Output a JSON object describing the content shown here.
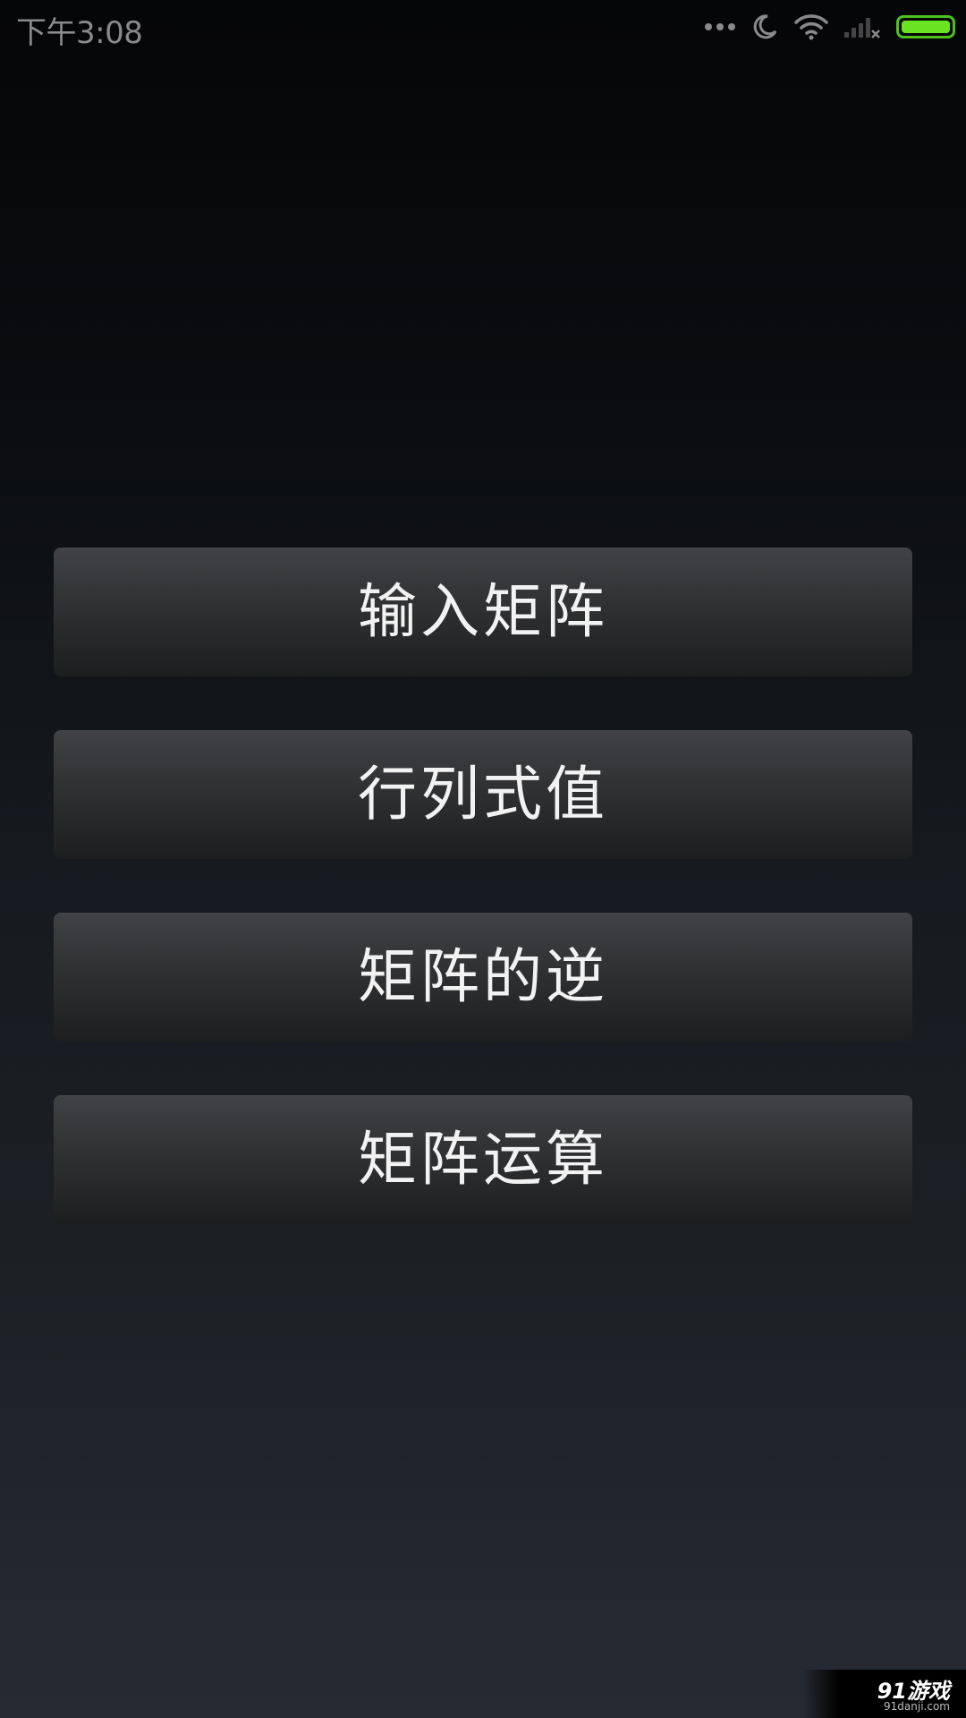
{
  "status_bar": {
    "time": "下午3:08",
    "icons": [
      "more-dots-icon",
      "moon-icon",
      "wifi-icon",
      "signal-none-icon",
      "battery-icon"
    ],
    "battery_color": "#6ae421"
  },
  "menu": {
    "items": [
      {
        "label": "输入矩阵"
      },
      {
        "label": "行列式值"
      },
      {
        "label": "矩阵的逆"
      },
      {
        "label": "矩阵运算"
      }
    ]
  },
  "watermark": {
    "logo": "91游戏",
    "url": "91danji.com"
  },
  "colors": {
    "button_text": "#f2f2f2",
    "button_top": "#414245",
    "button_bottom": "#1d1e1f",
    "battery": "#6ae421"
  }
}
